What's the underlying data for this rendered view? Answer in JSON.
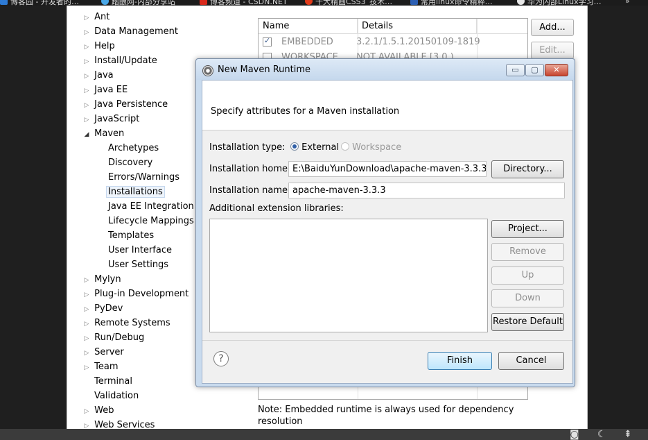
{
  "bookmarks": [
    {
      "label": "博客园 - 开发者的…",
      "color": "#2e7bd6"
    },
    {
      "label": "踏酿网-内部分享站",
      "color": "#4aa8e8"
    },
    {
      "label": "博客频道 - CSDN.NET",
      "color": "#d92a1c"
    },
    {
      "label": "十大精画CSS3_技术…",
      "color": "#e23b1a"
    },
    {
      "label": "常用linux命令精粹…",
      "color": "#2c5fb3"
    },
    {
      "label": "华为内部Linux学习…",
      "color": "#e8e8e8"
    },
    {
      "label": "»",
      "color": ""
    }
  ],
  "tree": {
    "items": [
      {
        "label": "Ant",
        "expander": "▷"
      },
      {
        "label": "Data Management",
        "expander": "▷"
      },
      {
        "label": "Help",
        "expander": "▷"
      },
      {
        "label": "Install/Update",
        "expander": "▷"
      },
      {
        "label": "Java",
        "expander": "▷"
      },
      {
        "label": "Java EE",
        "expander": "▷"
      },
      {
        "label": "Java Persistence",
        "expander": "▷"
      },
      {
        "label": "JavaScript",
        "expander": "▷"
      },
      {
        "label": "Maven",
        "expander": "◢"
      },
      {
        "label": "Archetypes",
        "expander": ""
      },
      {
        "label": "Discovery",
        "expander": ""
      },
      {
        "label": "Errors/Warnings",
        "expander": ""
      },
      {
        "label": "Installations",
        "expander": ""
      },
      {
        "label": "Java EE Integration",
        "expander": ""
      },
      {
        "label": "Lifecycle Mappings",
        "expander": ""
      },
      {
        "label": "Templates",
        "expander": ""
      },
      {
        "label": "User Interface",
        "expander": ""
      },
      {
        "label": "User Settings",
        "expander": ""
      },
      {
        "label": "Mylyn",
        "expander": "▷"
      },
      {
        "label": "Plug-in Development",
        "expander": "▷"
      },
      {
        "label": "PyDev",
        "expander": "▷"
      },
      {
        "label": "Remote Systems",
        "expander": "▷"
      },
      {
        "label": "Run/Debug",
        "expander": "▷"
      },
      {
        "label": "Server",
        "expander": "▷"
      },
      {
        "label": "Team",
        "expander": "▷"
      },
      {
        "label": "Terminal",
        "expander": ""
      },
      {
        "label": "Validation",
        "expander": ""
      },
      {
        "label": "Web",
        "expander": "▷"
      },
      {
        "label": "Web Services",
        "expander": "▷"
      }
    ]
  },
  "installations_table": {
    "headers": [
      "Name",
      "Details"
    ],
    "rows": [
      {
        "checked": true,
        "name": "EMBEDDED",
        "details": "3.2.1/1.5.1.20150109-1819"
      },
      {
        "checked": false,
        "name": "WORKSPACE",
        "details": "NOT AVAILABLE [3.0,)"
      }
    ],
    "buttons": {
      "add": "Add...",
      "edit": "Edit..."
    }
  },
  "note": "Note: Embedded runtime is always used for dependency resolution",
  "dialog": {
    "title": "New Maven Runtime",
    "banner_message": "Specify attributes for a Maven installation",
    "install_type_label": "Installation type:",
    "install_type_options": {
      "external": "External",
      "workspace": "Workspace"
    },
    "install_home_label": "Installation home:",
    "install_home_value": "E:\\BaiduYunDownload\\apache-maven-3.3.3",
    "directory_button": "Directory...",
    "install_name_label": "Installation name:",
    "install_name_value": "apache-maven-3.3.3",
    "ext_libraries_label": "Additional extension libraries:",
    "side_buttons": {
      "project": "Project...",
      "remove": "Remove",
      "up": "Up",
      "down": "Down",
      "restore": "Restore Default"
    },
    "help": "?",
    "finish": "Finish",
    "cancel": "Cancel",
    "window_buttons": {
      "minimize": "▭",
      "maximize": "▢",
      "close": "✕"
    }
  },
  "taskbar": {
    "icons": [
      "chat-icon",
      "moon-icon",
      "upload-icon"
    ]
  }
}
